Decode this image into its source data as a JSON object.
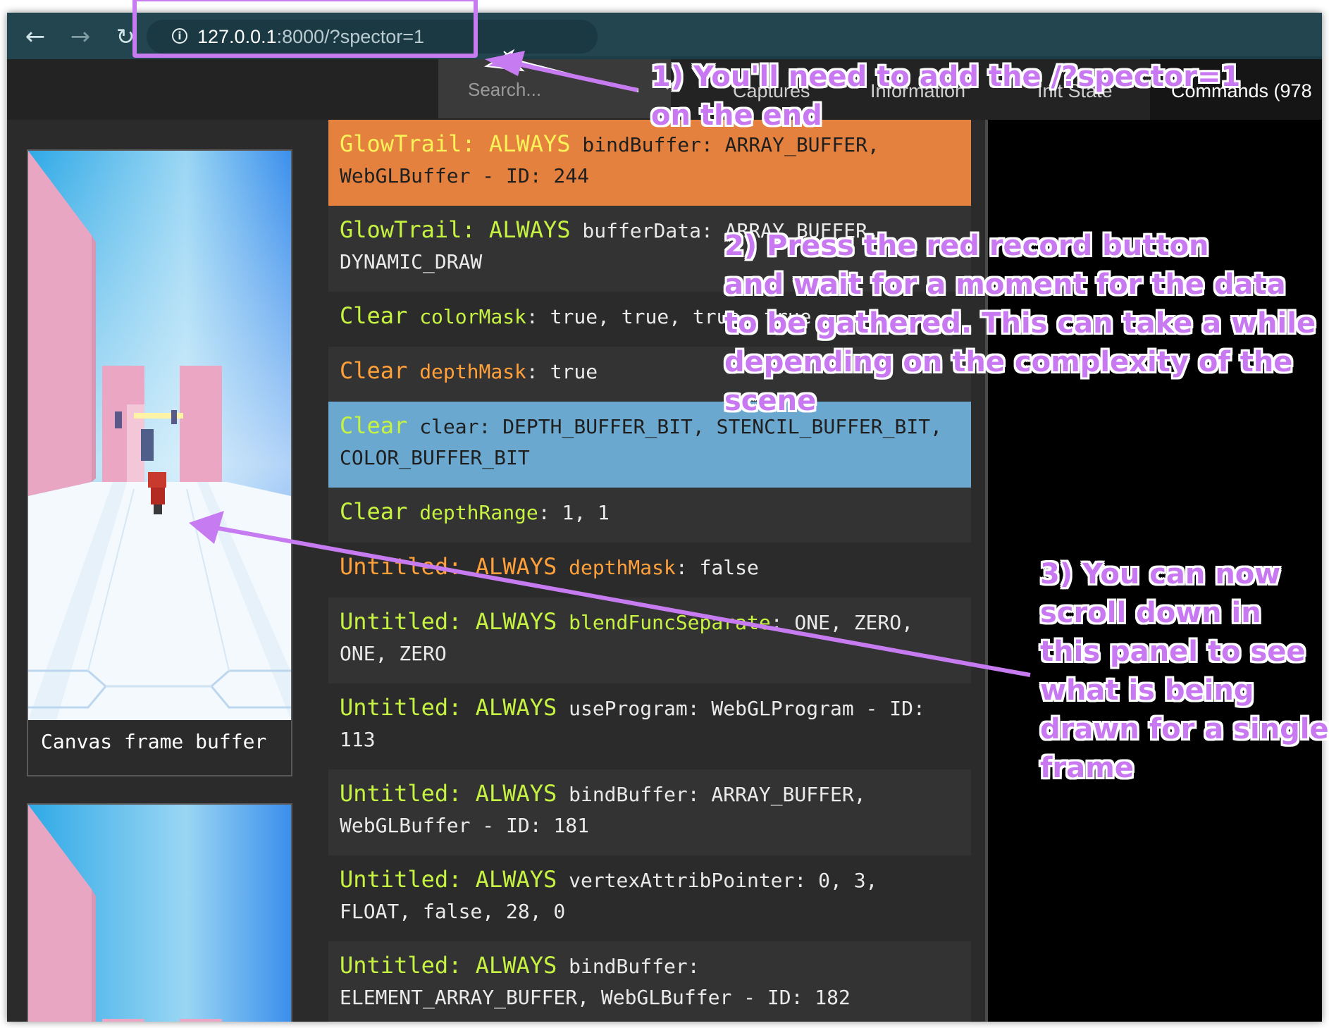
{
  "browser": {
    "back_icon": "arrow-left",
    "forward_icon": "arrow-right",
    "reload_icon": "reload",
    "info_icon": "info-circle",
    "url_host": "127.0.0.1",
    "url_rest": ":8000/?spector=1"
  },
  "header": {
    "search_placeholder": "Search...",
    "search_clear": "✕",
    "tabs": [
      "Captures",
      "Information",
      "Init State",
      "Commands (978"
    ]
  },
  "thumbnails": [
    {
      "caption": "Canvas frame buffer"
    },
    {
      "caption": ""
    }
  ],
  "commands": [
    {
      "label": "GlowTrail: ALWAYS",
      "fn": "bindBuffer",
      "args": ": ARRAY_BUFFER, WebGLBuffer - ID: 244",
      "state": "selected"
    },
    {
      "label": "GlowTrail: ALWAYS",
      "fn": "bufferData",
      "args": ": ARRAY_BUFFER, DYNAMIC_DRAW",
      "state": "normal"
    },
    {
      "label": "Clear",
      "fn": "colorMask",
      "args": ": true, true, true, true",
      "state": "plain"
    },
    {
      "label": "Clear",
      "fn": "depthMask",
      "args": ": true",
      "state": "normal"
    },
    {
      "label": "Clear",
      "fn": "clear",
      "args": ": DEPTH_BUFFER_BIT, STENCIL_BUFFER_BIT, COLOR_BUFFER_BIT",
      "state": "hover"
    },
    {
      "label": "Clear",
      "fn": "depthRange",
      "args": ": 1, 1",
      "state": "normal"
    },
    {
      "label": "Untitled: ALWAYS",
      "fn": "depthMask",
      "args": ": false",
      "state": "plain"
    },
    {
      "label": "Untitled: ALWAYS",
      "fn": "blendFuncSeparate",
      "args": ": ONE, ZERO, ONE, ZERO",
      "state": "normal"
    },
    {
      "label": "Untitled: ALWAYS",
      "fn": "useProgram",
      "args": ": WebGLProgram - ID: 113",
      "state": "plain"
    },
    {
      "label": "Untitled: ALWAYS",
      "fn": "bindBuffer",
      "args": ": ARRAY_BUFFER, WebGLBuffer - ID: 181",
      "state": "normal"
    },
    {
      "label": "Untitled: ALWAYS",
      "fn": "vertexAttribPointer",
      "args": ": 0, 3, FLOAT, false, 28, 0",
      "state": "plain"
    },
    {
      "label": "Untitled: ALWAYS",
      "fn": "bindBuffer",
      "args": ": ELEMENT_ARRAY_BUFFER, WebGLBuffer - ID: 182",
      "state": "normal"
    }
  ],
  "annotations": {
    "step1": "1) You'll need to add the /?spector=1\non the end",
    "step2": "2) Press the red record button\nand wait for a moment for the data\nto be gathered. This can take a while\ndepending on the complexity of the\nscene",
    "step3": "3) You can now\nscroll down in\nthis panel to see\nwhat is being\ndrawn for a single\nframe"
  },
  "colors": {
    "annotation": "#c879f2",
    "selected_row": "#e4813f",
    "hover_row": "#6aa8cf",
    "label_green": "#c6f241",
    "label_orange": "#ffa03a",
    "browser_bar": "#22454f"
  }
}
